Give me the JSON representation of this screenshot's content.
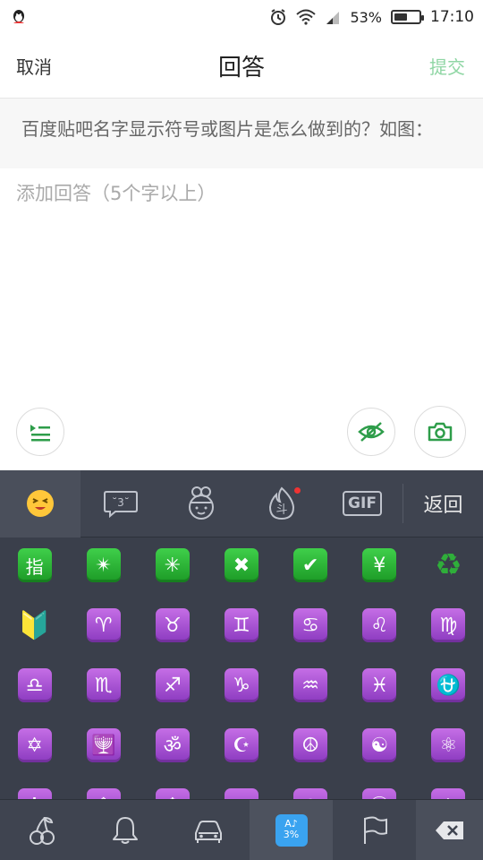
{
  "status_bar": {
    "battery": "53%",
    "battery_level": 0.53,
    "time": "17:10",
    "icons": [
      "qq-icon",
      "alarm-icon",
      "wifi-icon",
      "signal-icon",
      "battery-icon"
    ]
  },
  "header": {
    "cancel": "取消",
    "title": "回答",
    "submit": "提交"
  },
  "question": {
    "text": "百度贴吧名字显示符号或图片是怎么做到的？如图："
  },
  "answer": {
    "value": "",
    "placeholder": "添加回答（5个字以上）"
  },
  "tools": {
    "left": [
      "outline-list-icon"
    ],
    "right": [
      "eye-hidden-icon",
      "camera-icon"
    ]
  },
  "keyboard": {
    "tabs": {
      "back": "返回",
      "gif": "GIF",
      "kaomoji": "˘3˘"
    },
    "emoji_rows": [
      [
        {
          "g": "指",
          "c": "green"
        },
        {
          "g": "✴",
          "c": "green"
        },
        {
          "g": "✳",
          "c": "green"
        },
        {
          "g": "✖",
          "c": "green"
        },
        {
          "g": "✔",
          "c": "green"
        },
        {
          "g": "¥",
          "c": "green"
        },
        {
          "g": "♻",
          "c": "recycle"
        }
      ],
      [
        {
          "g": "🔰",
          "c": "plain"
        },
        {
          "g": "♈",
          "c": "purple"
        },
        {
          "g": "♉",
          "c": "purple"
        },
        {
          "g": "♊",
          "c": "purple"
        },
        {
          "g": "♋",
          "c": "purple"
        },
        {
          "g": "♌",
          "c": "purple"
        },
        {
          "g": "♍",
          "c": "purple"
        }
      ],
      [
        {
          "g": "♎",
          "c": "purple"
        },
        {
          "g": "♏",
          "c": "purple"
        },
        {
          "g": "♐",
          "c": "purple"
        },
        {
          "g": "♑",
          "c": "purple"
        },
        {
          "g": "♒",
          "c": "purple"
        },
        {
          "g": "♓",
          "c": "purple"
        },
        {
          "g": "⛎",
          "c": "purple"
        }
      ],
      [
        {
          "g": "✡",
          "c": "purple"
        },
        {
          "g": "🕎",
          "c": "purple"
        },
        {
          "g": "ॐ",
          "c": "purple"
        },
        {
          "g": "☪",
          "c": "purple"
        },
        {
          "g": "☮",
          "c": "purple"
        },
        {
          "g": "☯",
          "c": "purple"
        },
        {
          "g": "⚛",
          "c": "purple"
        }
      ],
      [
        {
          "g": "✝",
          "c": "purple"
        },
        {
          "g": "☦",
          "c": "purple"
        },
        {
          "g": "☸",
          "c": "purple"
        },
        {
          "g": "ID",
          "c": "purple"
        },
        {
          "g": "◉",
          "c": "purple"
        },
        {
          "g": "ⓘ",
          "c": "purple"
        },
        {
          "g": "空",
          "c": "purple"
        }
      ]
    ],
    "categories": [
      "cherries-icon",
      "bell-icon",
      "car-icon",
      "symbols-icon",
      "flag-icon"
    ],
    "symbols_badge": "A♪\n3%"
  },
  "colors": {
    "accent_green": "#8fd6a4",
    "keyboard_bg": "#3a3f4b"
  }
}
